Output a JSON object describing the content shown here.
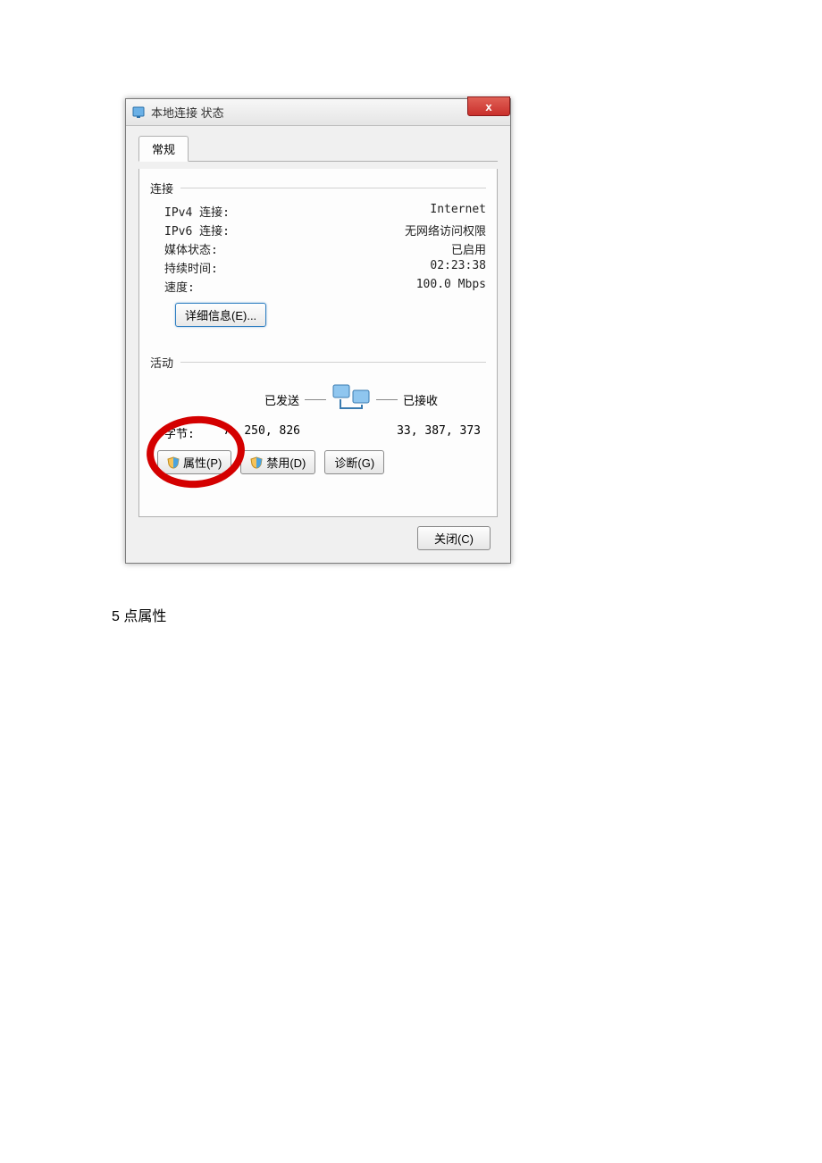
{
  "dialog": {
    "title": "本地连接 状态",
    "close_x": "x",
    "tab_label": "常规",
    "connection": {
      "section": "连接",
      "rows": [
        {
          "key": "IPv4 连接:",
          "val": "Internet"
        },
        {
          "key": "IPv6 连接:",
          "val": "无网络访问权限"
        },
        {
          "key": "媒体状态:",
          "val": "已启用"
        },
        {
          "key": "持续时间:",
          "val": "02:23:38"
        },
        {
          "key": "速度:",
          "val": "100.0 Mbps"
        }
      ],
      "details_btn": "详细信息(E)..."
    },
    "activity": {
      "section": "活动",
      "sent_label": "已发送",
      "recv_label": "已接收",
      "bytes_label": "字节:",
      "sent_bytes": "7, 250, 826",
      "recv_bytes": "33, 387, 373"
    },
    "buttons": {
      "properties": "属性(P)",
      "disable": "禁用(D)",
      "diagnose": "诊断(G)",
      "close": "关闭(C)"
    }
  },
  "caption": "5 点属性"
}
